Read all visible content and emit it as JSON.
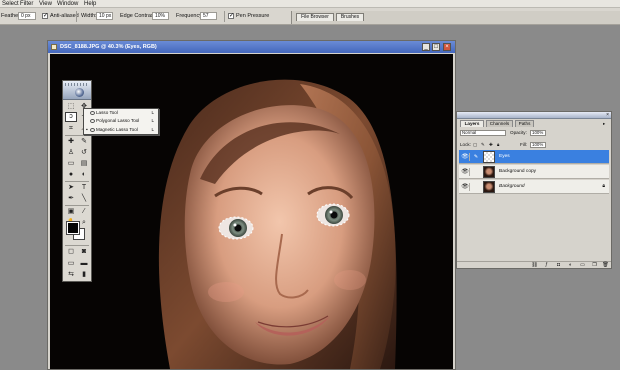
{
  "menubar": {
    "items": [
      "Select",
      "Filter",
      "View",
      "Window",
      "Help"
    ]
  },
  "options": {
    "feather_label": "Feather:",
    "feather_value": "0 px",
    "antialiased_label": "Anti-aliased",
    "width_label": "Width:",
    "width_value": "10 px",
    "edge_contrast_label": "Edge Contrast:",
    "edge_contrast_value": "10%",
    "frequency_label": "Frequency:",
    "frequency_value": "57",
    "pen_pressure_label": "Pen Pressure"
  },
  "palette_well": {
    "tabs": [
      "File Browser",
      "Brushes"
    ]
  },
  "document": {
    "title": "DSC_8188.JPG @ 40.3% (Eyes, RGB)",
    "minimize_glyph": "_",
    "maximize_glyph": "□",
    "close_glyph": "×"
  },
  "lasso_flyout": {
    "items": [
      {
        "label": "Lasso Tool",
        "key": "L",
        "selected": false
      },
      {
        "label": "Polygonal Lasso Tool",
        "key": "L",
        "selected": false
      },
      {
        "label": "Magnetic Lasso Tool",
        "key": "L",
        "selected": true
      }
    ],
    "bullet": "▪"
  },
  "layers_panel": {
    "tabs": [
      "Layers",
      "Channels",
      "Paths"
    ],
    "close_glyph": "×",
    "blend_mode": "Normal",
    "opacity_label": "Opacity:",
    "opacity_value": "100%",
    "lock_label": "Lock:",
    "fill_label": "Fill:",
    "fill_value": "100%",
    "layers": [
      {
        "name": "Eyes",
        "active": true,
        "visible": true,
        "locked": false,
        "italic": false
      },
      {
        "name": "Background copy",
        "active": false,
        "visible": true,
        "locked": false,
        "italic": false
      },
      {
        "name": "Background",
        "active": false,
        "visible": true,
        "locked": true,
        "italic": true
      }
    ]
  },
  "colors": {
    "accent": "#3a80e0",
    "title_bar": "#4467bd",
    "foreground_swatch": "#050505",
    "background_swatch": "#ffffff"
  }
}
